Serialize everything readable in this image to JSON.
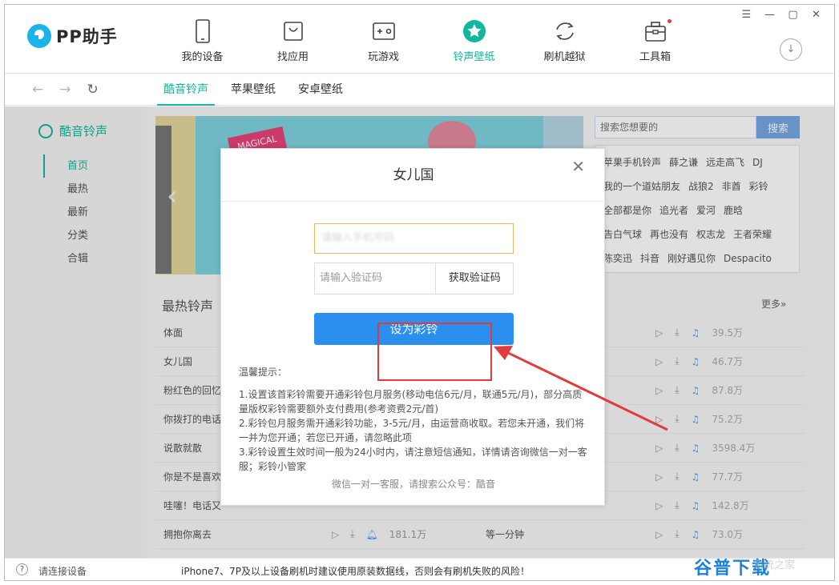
{
  "app": {
    "logo_text": "PP助手"
  },
  "window_controls": [
    "☰",
    "—",
    "▢",
    "✕"
  ],
  "nav": [
    {
      "label": "我的设备",
      "icon": "phone-icon"
    },
    {
      "label": "找应用",
      "icon": "bag-icon"
    },
    {
      "label": "玩游戏",
      "icon": "gamepad-icon"
    },
    {
      "label": "铃声壁纸",
      "icon": "star-icon",
      "active": true
    },
    {
      "label": "刷机越狱",
      "icon": "refresh-icon"
    },
    {
      "label": "工具箱",
      "icon": "toolbox-icon"
    }
  ],
  "subtabs": [
    "酷音铃声",
    "苹果壁纸",
    "安卓壁纸"
  ],
  "sidebar": {
    "title": "酷音铃声",
    "items": [
      "首页",
      "最热",
      "最新",
      "分类",
      "合辑"
    ]
  },
  "banner": {
    "tag": "MAGICAL"
  },
  "search": {
    "placeholder": "搜索您想要的",
    "button": "搜索"
  },
  "tags": [
    "苹果手机铃声",
    "薛之谦",
    "远走高飞",
    "DJ",
    "我的一个道姑朋友",
    "战狼2",
    "非酋",
    "彩铃",
    "全部都是你",
    "追光者",
    "爱河",
    "鹿晗",
    "告白气球",
    "再也没有",
    "权志龙",
    "王者荣耀",
    "陈奕迅",
    "抖音",
    "刚好遇见你",
    "Despacito"
  ],
  "hot": {
    "title": "最热铃声",
    "more": "更多»",
    "rows": [
      {
        "name": "体面",
        "plays": "39.5万"
      },
      {
        "name": "女儿国",
        "plays": "46.7万"
      },
      {
        "name": "粉红色的回忆",
        "plays": "87.8万"
      },
      {
        "name": "你拨打的电话",
        "plays": "75.2万"
      },
      {
        "name": "说散就散",
        "plays": "3598.4万"
      },
      {
        "name": "你是不是喜欢",
        "plays": "77.7万"
      },
      {
        "name": "哇噻！电话又",
        "plays": "142.8万"
      },
      {
        "name": "拥抱你离去",
        "plays": "73.0万",
        "mid_plays": "181.1万",
        "album": "等一分钟"
      }
    ]
  },
  "status": {
    "connect": "请连接设备",
    "warning": "iPhone7、7P及以上设备刷机时建议使用原装数据线，否则会有刷机失败的风险！"
  },
  "watermark": {
    "text": "谷普下载",
    "sub": "系统之家"
  },
  "modal": {
    "title": "女儿国",
    "close": "✕",
    "phone_placeholder": "请输入手机号码",
    "code_placeholder": "请输入验证码",
    "get_code": "获取验证码",
    "set_button": "设为彩铃",
    "tips_title": "温馨提示：",
    "tips": [
      "1.设置该首彩铃需要开通彩铃包月服务(移动电信6元/月，联通5元/月)，部分高质量版权彩铃需要额外支付费用(参考资费2元/首)",
      "2.彩铃包月服务需开通彩铃功能，3-5元/月，由运营商收取。若您未开通，我们将一并为您开通；若您已开通，请忽略此项",
      "3.彩铃设置生效时间一般为24小时内，请注意短信通知，详情请咨询微信一对一客服；彩铃小管家"
    ],
    "footer": "微信一对一客服，请搜索公众号：酷音"
  },
  "colors": {
    "accent": "#10b79c",
    "primary_button": "#2b8ff0",
    "annotation": "#e23b3b"
  }
}
